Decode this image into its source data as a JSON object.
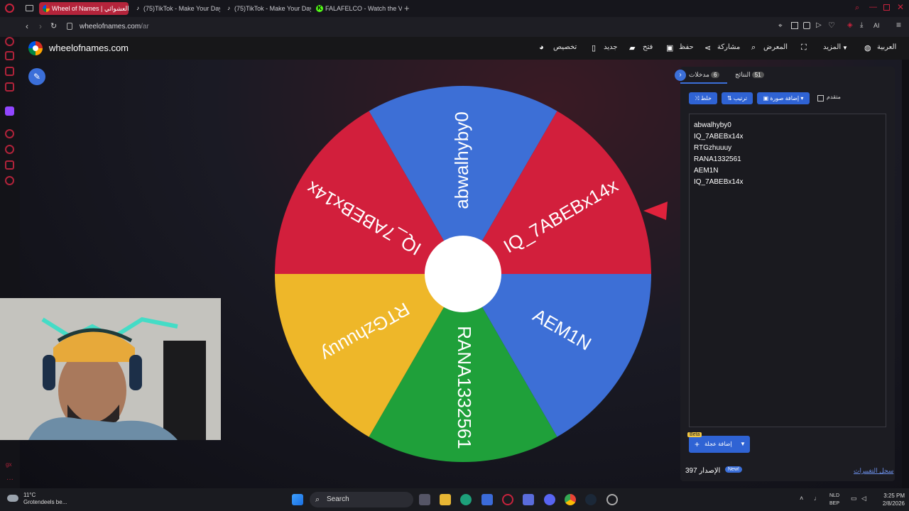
{
  "browser": {
    "tabs": [
      {
        "label": "Wheel of Names | عجلة العشوائي",
        "active": true
      },
      {
        "label": "(75)TikTok - Make Your Day",
        "active": false
      },
      {
        "label": "(75)TikTok - Make Your Day",
        "active": false
      },
      {
        "label": "FALAFELCO - Watch the V",
        "active": false
      }
    ],
    "url_host": "wheelofnames.com",
    "url_path": "/ar",
    "ai_label": "AI"
  },
  "site": {
    "title": "wheelofnames.com",
    "nav": {
      "customize": "تخصيص",
      "new": "جديد",
      "open": "فتح",
      "save": "حفظ",
      "share": "مشاركة",
      "gallery": "المعرض",
      "more": "المزيد",
      "language": "العربية"
    }
  },
  "wheel": {
    "segments": [
      {
        "label": "abwalhyby0",
        "color": "#3d6fd6"
      },
      {
        "label": "IQ_7ABEBx14x",
        "color": "#d21f3c"
      },
      {
        "label": "AEM1N",
        "color": "#3d6fd6"
      },
      {
        "label": "RANA1332561",
        "color": "#1fa03a"
      },
      {
        "label": "RTGzhuuuy",
        "color": "#eeb729"
      },
      {
        "label": "IQ_7ABEBx14x",
        "color": "#d21f3c"
      }
    ],
    "pointer_color": "#e0223c"
  },
  "panel": {
    "tab_entries": {
      "label": "مدخلات",
      "count": "6"
    },
    "tab_results": {
      "label": "النتائج",
      "count": "51"
    },
    "shuffle_label": "خلط",
    "sort_label": "ترتيب",
    "add_image_label": "إضافة صورة",
    "advanced_label": "متقدم",
    "entries": [
      "abwalhyby0",
      "IQ_7ABEBx14x",
      "RTGzhuuuy",
      "RANA1332561",
      "AEM1N",
      "IQ_7ABEBx14x"
    ],
    "beta_label": "Beta",
    "add_wheel_label": "إضافة عجلة",
    "version_label": "الإصدار 397",
    "new_label": "New!",
    "changelog_label": "سجل التغييرات"
  },
  "taskbar": {
    "weather_temp": "11°C",
    "weather_desc": "Grotendeels be...",
    "search_label": "Search",
    "lang_top": "NLD",
    "lang_bottom": "BEP",
    "time": "3:25 PM",
    "date": "2/8/2026"
  }
}
